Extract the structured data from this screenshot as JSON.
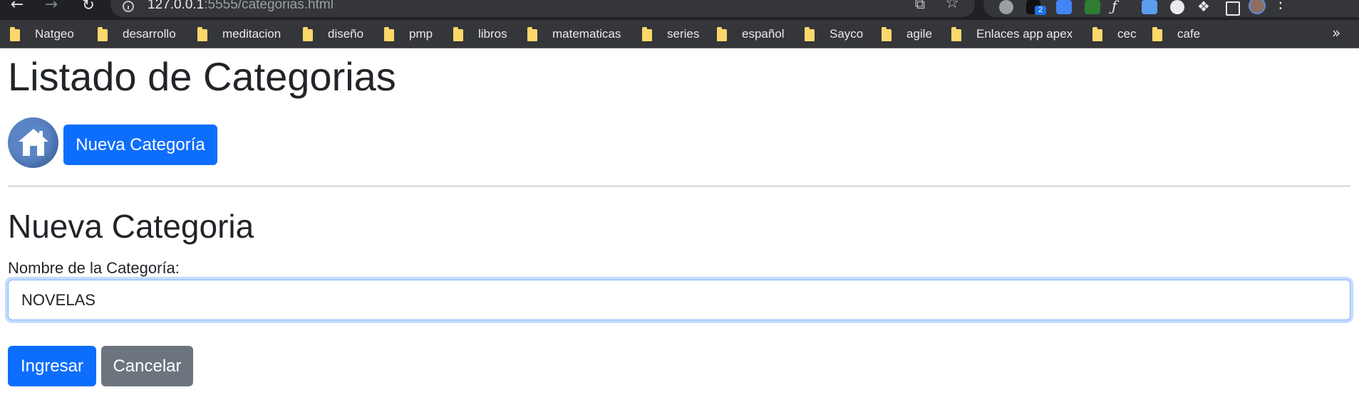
{
  "browser": {
    "url_host": "127.0.0.1",
    "url_path": ":5555/categorias.html",
    "extension_badge": "2",
    "bookmarks": [
      "Natgeo",
      "desarrollo",
      "meditacion",
      "diseño",
      "pmp",
      "libros",
      "matematicas",
      "series",
      "español",
      "Sayco",
      "agile",
      "Enlaces app apex",
      "cec",
      "cafe"
    ],
    "icons": {
      "back": "arrow-left-icon",
      "forward": "arrow-right-icon",
      "reload": "reload-icon",
      "info": "info-icon",
      "share": "share-icon",
      "bookmark_star": "star-icon",
      "folder": "folder-icon",
      "more": "chevron-double-right-icon",
      "menu": "kebab-menu-icon"
    },
    "colors": {
      "chrome_dark": "#202124",
      "chrome_bar": "#35363a",
      "folder": "#fcd86b"
    }
  },
  "page": {
    "title": "Listado de Categorias",
    "home_icon": "house-icon",
    "new_category_button": "Nueva Categoría",
    "form_title": "Nueva Categoria",
    "name_label": "Nombre de la Categoría:",
    "name_value": "NOVELAS",
    "submit_button": "Ingresar",
    "cancel_button": "Cancelar",
    "colors": {
      "primary": "#0d6efd",
      "secondary": "#6c757d",
      "text": "#212529"
    }
  }
}
